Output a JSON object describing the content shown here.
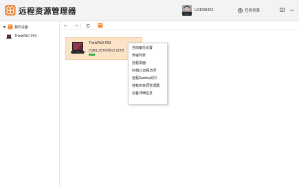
{
  "app": {
    "title": "远程资源管理器",
    "username": "USER8426",
    "task_list_label": "任务列表",
    "accent_color": "#e8782a"
  },
  "sidebar": {
    "root_label": "我的设备",
    "devices": [
      {
        "label": "ThinkPAD P53"
      }
    ]
  },
  "toolbar": {
    "icons": [
      "back-icon",
      "forward-icon",
      "refresh-icon",
      "device-folder-icon"
    ]
  },
  "main": {
    "device": {
      "name": "ThinkPAD P53",
      "usage_text": "已用1.35TB/共10.92TB",
      "usage_percent": 12.4,
      "usage_color": "#2fb344"
    }
  },
  "context_menu": {
    "items": [
      "自动备份设置",
      "传输列表",
      "远程桌面",
      "80端口远程访问",
      "远程Samba访问",
      "挂载到资源管理器",
      "设备详细信息"
    ]
  }
}
